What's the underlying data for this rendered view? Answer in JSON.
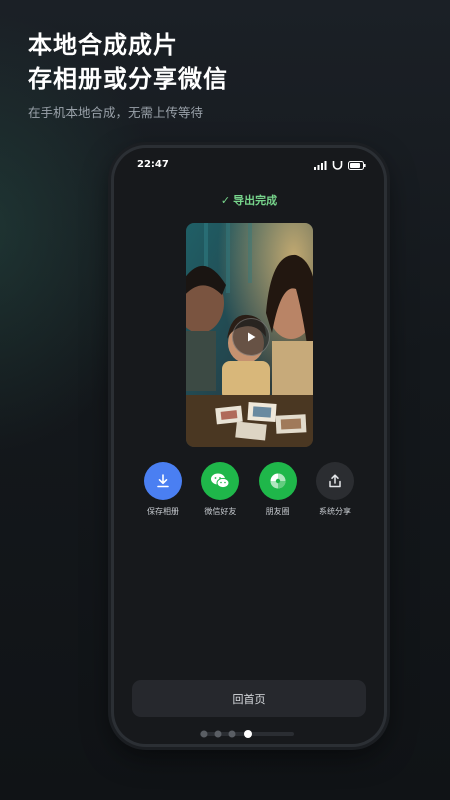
{
  "headline": {
    "line1": "本地合成成片",
    "line2": "存相册或分享微信"
  },
  "subtitle": "在手机本地合成，无需上传等待",
  "phone": {
    "status_time": "22:47",
    "export_status": "导出完成",
    "video_play_icon": "play-icon",
    "share_targets": [
      {
        "label": "保存相册",
        "icon": "download-icon",
        "color": "#4a7ff2"
      },
      {
        "label": "微信好友",
        "icon": "wechat-icon",
        "color": "#1fb74a"
      },
      {
        "label": "朋友圈",
        "icon": "moments-icon",
        "color": "#1fb74a"
      },
      {
        "label": "系统分享",
        "icon": "share-icon",
        "color": "#2b2d31"
      }
    ],
    "home_button": "回首页"
  },
  "pager": {
    "count": 4,
    "active_index": 3
  },
  "colors": {
    "accent_green": "#77d48b",
    "background": "#14181c"
  }
}
